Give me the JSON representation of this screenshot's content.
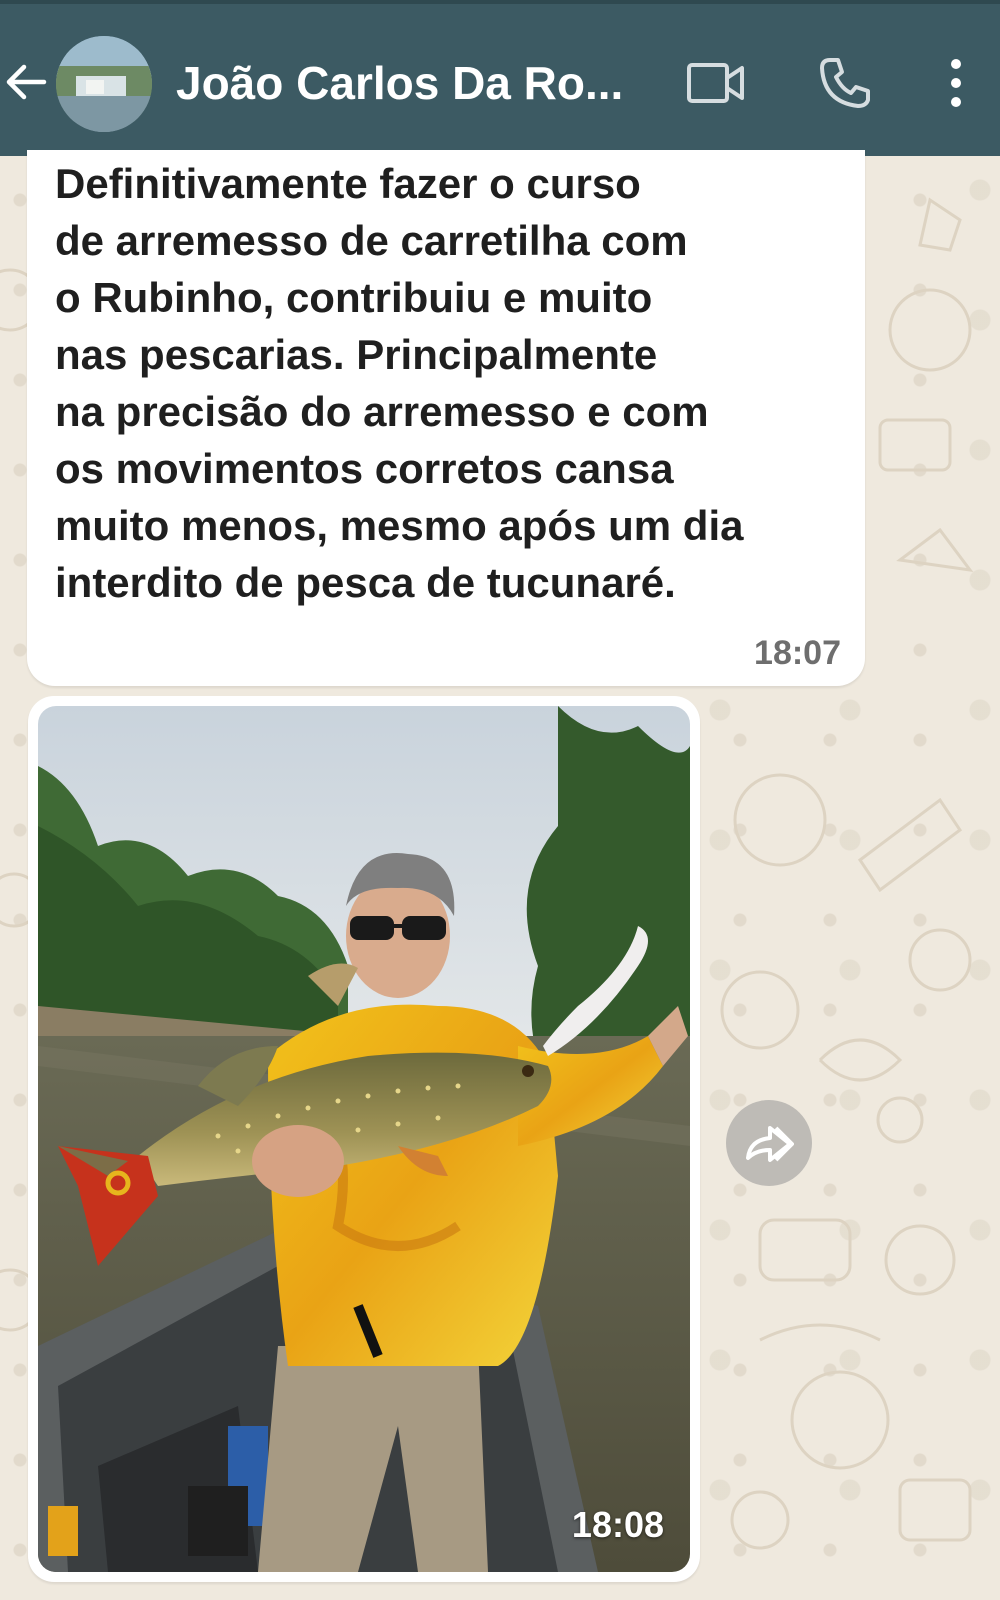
{
  "header": {
    "contact_name": "João Carlos Da Ro..."
  },
  "messages": [
    {
      "type": "text",
      "lines": [
        "Definitivamente fazer o curso",
        "de arremesso de carretilha com",
        "o Rubinho, contribuiu e muito",
        "nas pescarias. Principalmente",
        "na precisão do arremesso e com",
        "os movimentos corretos cansa",
        "muito menos, mesmo após um dia",
        "interdito de pesca de tucunaré."
      ],
      "time": "18:07"
    },
    {
      "type": "image",
      "time": "18:08"
    }
  ],
  "icons": {
    "back": "arrow-left",
    "video": "video-camera",
    "call": "phone",
    "menu": "more-vertical",
    "forward": "double-forward-arrow"
  },
  "colors": {
    "header_bg": "#3c5a63",
    "bubble_bg": "#ffffff",
    "wallpaper": "#efe9de"
  }
}
